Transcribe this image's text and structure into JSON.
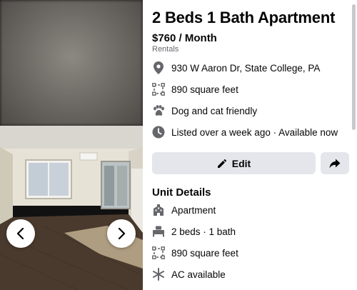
{
  "listing": {
    "title": "2 Beds 1 Bath Apartment",
    "price": "$760 / Month",
    "category": "Rentals"
  },
  "info_rows": [
    {
      "icon": "location-pin-icon",
      "text": "930 W Aaron Dr, State College, PA"
    },
    {
      "icon": "square-feet-icon",
      "text": "890 square feet"
    },
    {
      "icon": "paw-icon",
      "text": "Dog and cat friendly"
    },
    {
      "icon": "clock-icon",
      "text": "Listed over a week ago · Available now"
    }
  ],
  "actions": {
    "edit_label": "Edit",
    "share_icon": "share-icon"
  },
  "unit_details": {
    "heading": "Unit Details",
    "items": [
      {
        "icon": "building-icon",
        "text": "Apartment"
      },
      {
        "icon": "bed-icon",
        "text": "2 beds · 1 bath"
      },
      {
        "icon": "square-feet-icon",
        "text": "890 square feet"
      },
      {
        "icon": "snowflake-icon",
        "text": "AC available"
      }
    ]
  },
  "gallery": {
    "prev_icon": "chevron-left-icon",
    "next_icon": "chevron-right-icon"
  },
  "colors": {
    "icon_gray": "#65676b",
    "button_bg": "#e4e6eb",
    "text": "#050505",
    "secondary_text": "#65676b"
  }
}
